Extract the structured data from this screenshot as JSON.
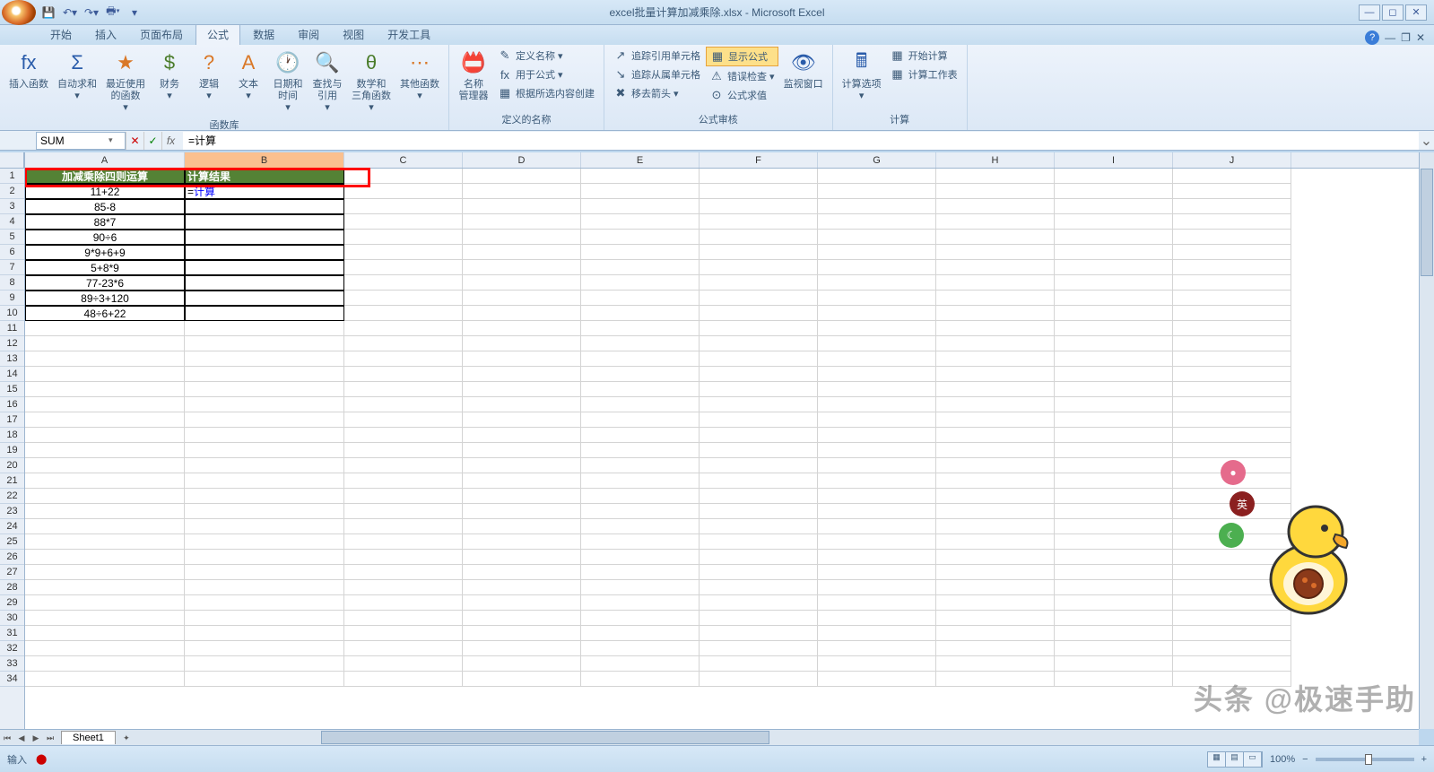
{
  "title": "excel批量计算加减乘除.xlsx - Microsoft Excel",
  "tabs": [
    "开始",
    "插入",
    "页面布局",
    "公式",
    "数据",
    "审阅",
    "视图",
    "开发工具"
  ],
  "active_tab": "公式",
  "ribbon": {
    "groups": [
      {
        "label": "函数库",
        "items": [
          {
            "icon": "fx",
            "label": "插入函数"
          },
          {
            "icon": "Σ",
            "label": "自动求和",
            "dd": true
          },
          {
            "icon": "★",
            "label": "最近使用\n的函数",
            "dd": true
          },
          {
            "icon": "$",
            "label": "财务",
            "dd": true
          },
          {
            "icon": "?",
            "label": "逻辑",
            "dd": true
          },
          {
            "icon": "A",
            "label": "文本",
            "dd": true
          },
          {
            "icon": "🕐",
            "label": "日期和\n时间",
            "dd": true
          },
          {
            "icon": "🔍",
            "label": "查找与\n引用",
            "dd": true
          },
          {
            "icon": "θ",
            "label": "数学和\n三角函数",
            "dd": true
          },
          {
            "icon": "⋯",
            "label": "其他函数",
            "dd": true
          }
        ]
      },
      {
        "label": "定义的名称",
        "big": {
          "icon": "📛",
          "label": "名称\n管理器"
        },
        "small": [
          {
            "icon": "✎",
            "label": "定义名称 ▾"
          },
          {
            "icon": "fx",
            "label": "用于公式 ▾"
          },
          {
            "icon": "▦",
            "label": "根据所选内容创建"
          }
        ]
      },
      {
        "label": "公式审核",
        "small_cols": [
          [
            {
              "icon": "↗",
              "label": "追踪引用单元格"
            },
            {
              "icon": "↘",
              "label": "追踪从属单元格"
            },
            {
              "icon": "✖",
              "label": "移去箭头 ▾"
            }
          ],
          [
            {
              "icon": "▦",
              "label": "显示公式",
              "hl": true
            },
            {
              "icon": "⚠",
              "label": "错误检查 ▾"
            },
            {
              "icon": "⊙",
              "label": "公式求值"
            }
          ]
        ],
        "big": {
          "icon": "👁",
          "label": "监视窗口"
        }
      },
      {
        "label": "计算",
        "big": {
          "icon": "🖩",
          "label": "计算选项",
          "dd": true
        },
        "small": [
          {
            "icon": "▦",
            "label": "开始计算"
          },
          {
            "icon": "▦",
            "label": "计算工作表"
          }
        ]
      }
    ]
  },
  "name_box": "SUM",
  "formula": "=计算",
  "columns": [
    "A",
    "B",
    "C",
    "D",
    "E",
    "F",
    "G",
    "H",
    "I",
    "J"
  ],
  "header_row": {
    "a": "加减乘除四则运算",
    "b": "计算结果"
  },
  "data_rows": [
    {
      "a": "11+22",
      "b": "=计算"
    },
    {
      "a": "85-8",
      "b": ""
    },
    {
      "a": "88*7",
      "b": ""
    },
    {
      "a": "90÷6",
      "b": ""
    },
    {
      "a": "9*9+6+9",
      "b": ""
    },
    {
      "a": "5+8*9",
      "b": ""
    },
    {
      "a": "77-23*6",
      "b": ""
    },
    {
      "a": "89÷3+120",
      "b": ""
    },
    {
      "a": "48÷6+22",
      "b": ""
    }
  ],
  "total_rows": 34,
  "sheet_tabs": [
    "Sheet1"
  ],
  "status": "输入",
  "zoom": "100%",
  "zoom_plus": "+",
  "zoom_minus": "−",
  "watermark": "头条 @极速手助",
  "bubble_text": "英"
}
